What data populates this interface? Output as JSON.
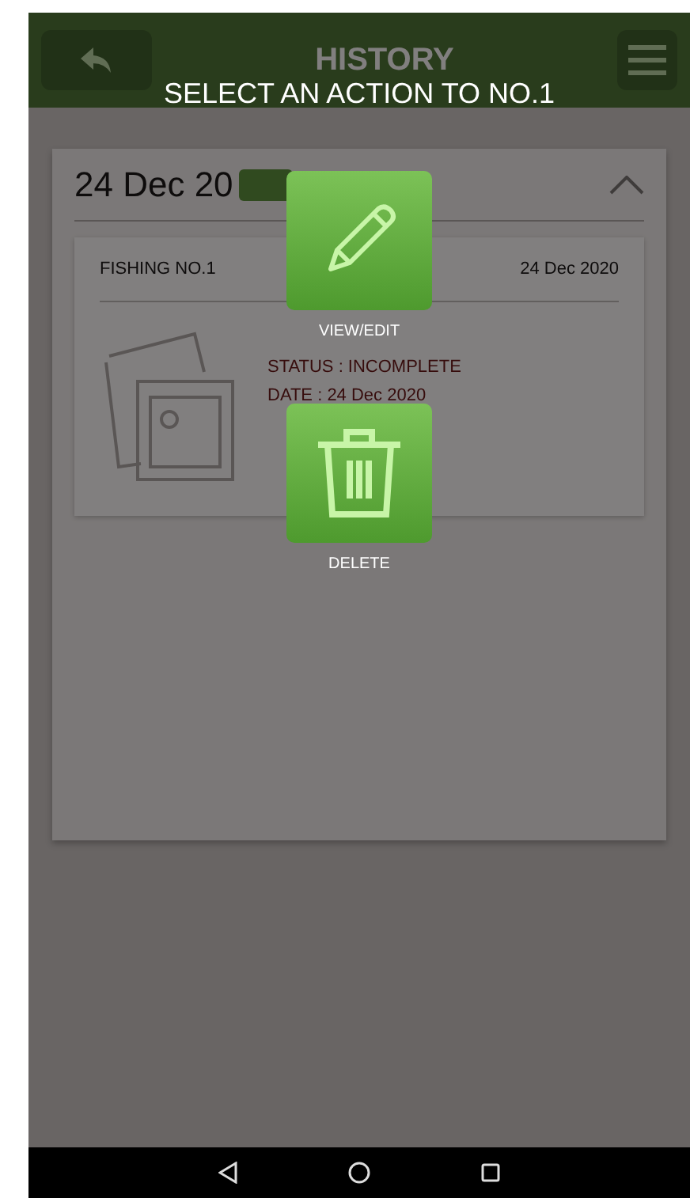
{
  "app_bar": {
    "title": "HISTORY"
  },
  "history_group": {
    "date": "24 Dec 20",
    "expanded": true,
    "entry": {
      "title": "FISHING NO.1",
      "date": "24 Dec 2020",
      "details": [
        "STATUS : INCOMPLETE",
        "DATE : 24 Dec 2020"
      ]
    }
  },
  "dialog": {
    "title": "SELECT AN ACTION TO NO.1",
    "actions": [
      {
        "kind": "edit",
        "label": "VIEW/EDIT"
      },
      {
        "kind": "delete",
        "label": "DELETE"
      }
    ]
  }
}
